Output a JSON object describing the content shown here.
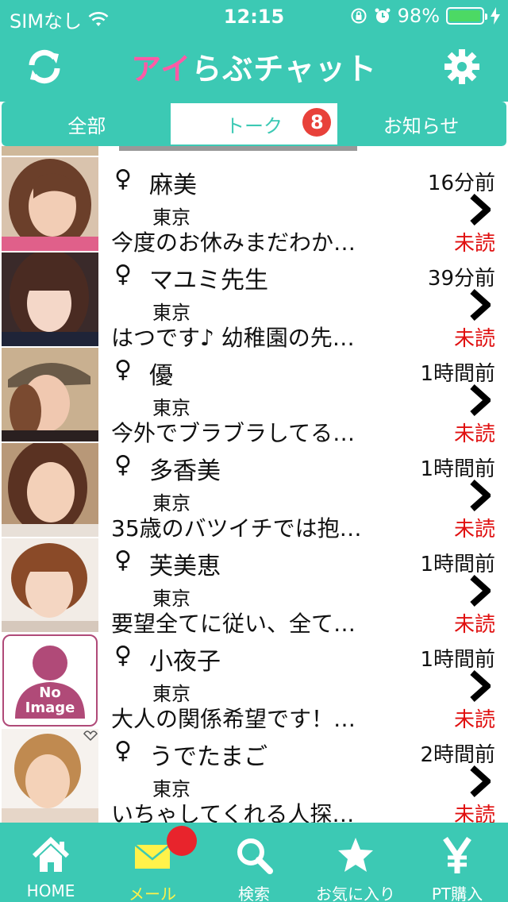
{
  "status": {
    "carrier": "SIMなし",
    "time": "12:15",
    "battery": "98%",
    "battery_level": 0.98
  },
  "header": {
    "logo_part1": "アイ",
    "logo_part2": "らぶチャット",
    "refresh_icon": "refresh-icon",
    "settings_icon": "gear-icon"
  },
  "tabs": {
    "all": "全部",
    "talk": "トーク",
    "talk_badge": "8",
    "notice": "お知らせ"
  },
  "messages": [
    {
      "gender": "♀",
      "name": "麻美",
      "time": "16分前",
      "area": "東京",
      "preview": "今度のお休みまだわか…",
      "status": "未読"
    },
    {
      "gender": "♀",
      "name": "マユミ先生",
      "time": "39分前",
      "area": "東京",
      "preview": "はつです♪ 幼稚園の先…",
      "status": "未読"
    },
    {
      "gender": "♀",
      "name": "優",
      "time": "1時間前",
      "area": "東京",
      "preview": "今外でブラブラしてる…",
      "status": "未読"
    },
    {
      "gender": "♀",
      "name": "多香美",
      "time": "1時間前",
      "area": "東京",
      "preview": "35歳のバツイチでは抱…",
      "status": "未読"
    },
    {
      "gender": "♀",
      "name": "芙美恵",
      "time": "1時間前",
      "area": "東京",
      "preview": "要望全てに従い、全て…",
      "status": "未読"
    },
    {
      "gender": "♀",
      "name": "小夜子",
      "time": "1時間前",
      "area": "東京",
      "preview": "大人の関係希望です！…",
      "status": "未読",
      "no_image_line1": "No",
      "no_image_line2": "Image"
    },
    {
      "gender": "♀",
      "name": "うでたまご",
      "time": "2時間前",
      "area": "東京",
      "preview": "いちゃしてくれる人探…",
      "status": "未読"
    }
  ],
  "nav": [
    {
      "label": "HOME",
      "icon": "home-icon"
    },
    {
      "label": "メール",
      "icon": "mail-icon"
    },
    {
      "label": "検索",
      "icon": "search-icon"
    },
    {
      "label": "お気に入り",
      "icon": "star-icon"
    },
    {
      "label": "PT購入",
      "icon": "yen-icon"
    }
  ],
  "colors": {
    "accent": "#3cc9b4",
    "unread": "#e01010",
    "badge": "#e8413a",
    "active_nav": "#fff24a"
  }
}
